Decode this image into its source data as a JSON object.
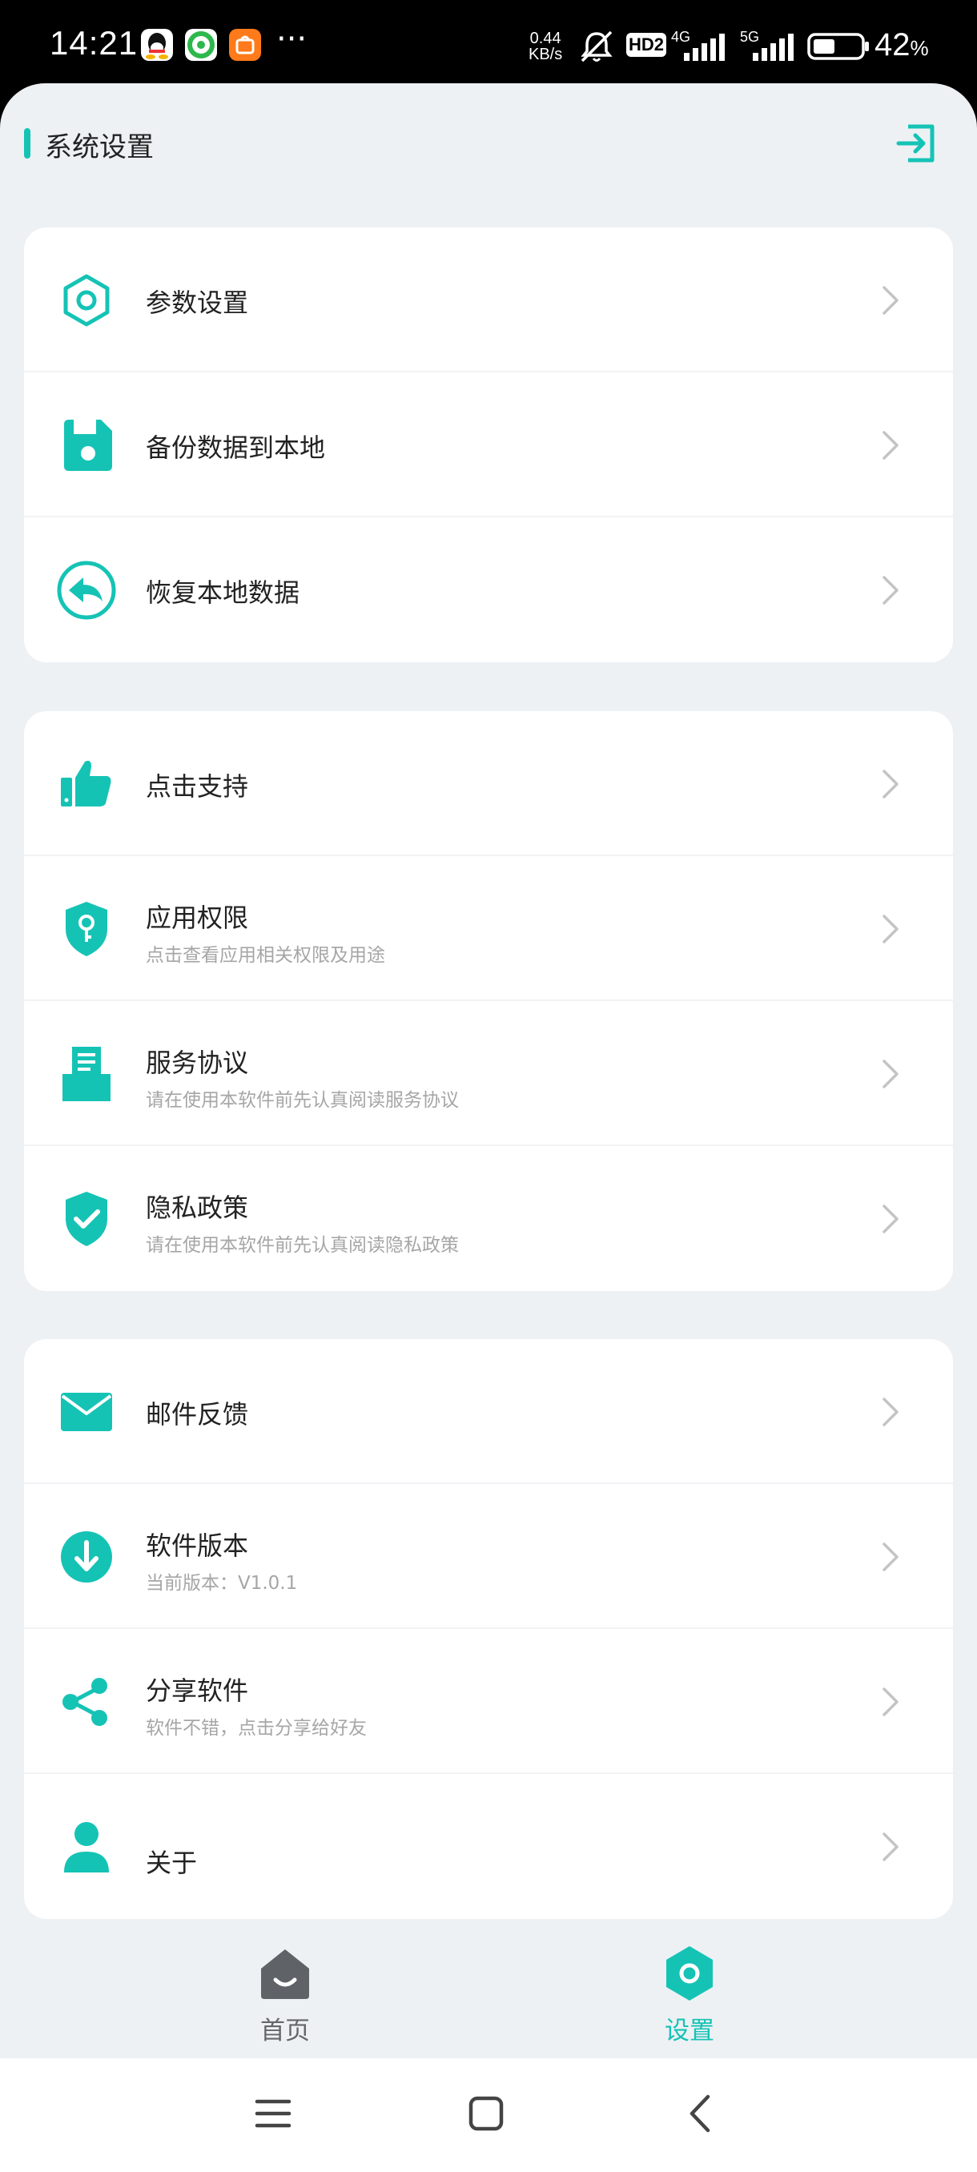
{
  "status_bar": {
    "time": "14:21",
    "net_speed_value": "0.44",
    "net_speed_unit": "KB/s",
    "hd_badge": "HD2",
    "sim1_type": "4G",
    "sim2_type": "5G",
    "battery": "42",
    "battery_unit": "%",
    "more_dots": "···"
  },
  "header": {
    "title": "系统设置",
    "logout_icon": "logout-icon"
  },
  "groups": [
    {
      "items": [
        {
          "icon": "hexagon-settings-icon",
          "label": "参数设置"
        },
        {
          "icon": "save-icon",
          "label": "备份数据到本地"
        },
        {
          "icon": "restore-icon",
          "label": "恢复本地数据"
        }
      ]
    },
    {
      "items": [
        {
          "icon": "thumbs-up-icon",
          "label": "点击支持"
        },
        {
          "icon": "shield-key-icon",
          "label": "应用权限",
          "subtitle": "点击查看应用相关权限及用途"
        },
        {
          "icon": "agreement-icon",
          "label": "服务协议",
          "subtitle": "请在使用本软件前先认真阅读服务协议"
        },
        {
          "icon": "shield-check-icon",
          "label": "隐私政策",
          "subtitle": "请在使用本软件前先认真阅读隐私政策"
        }
      ]
    },
    {
      "items": [
        {
          "icon": "mail-icon",
          "label": "邮件反馈"
        },
        {
          "icon": "download-icon",
          "label": "软件版本",
          "subtitle": "当前版本：V1.0.1"
        },
        {
          "icon": "share-icon",
          "label": "分享软件",
          "subtitle": "软件不错，点击分享给好友"
        },
        {
          "icon": "user-icon",
          "label": "关于"
        }
      ]
    }
  ],
  "tabbar": {
    "tabs": [
      {
        "label": "首页",
        "icon": "home-icon",
        "active": false
      },
      {
        "label": "设置",
        "icon": "settings-icon",
        "active": true
      }
    ]
  },
  "colors": {
    "accent": "#15c3b5",
    "background": "#edf1f4",
    "card": "#ffffff",
    "text": "#222222",
    "subtext": "#a6a6a6",
    "inactive_tab": "#666666"
  }
}
